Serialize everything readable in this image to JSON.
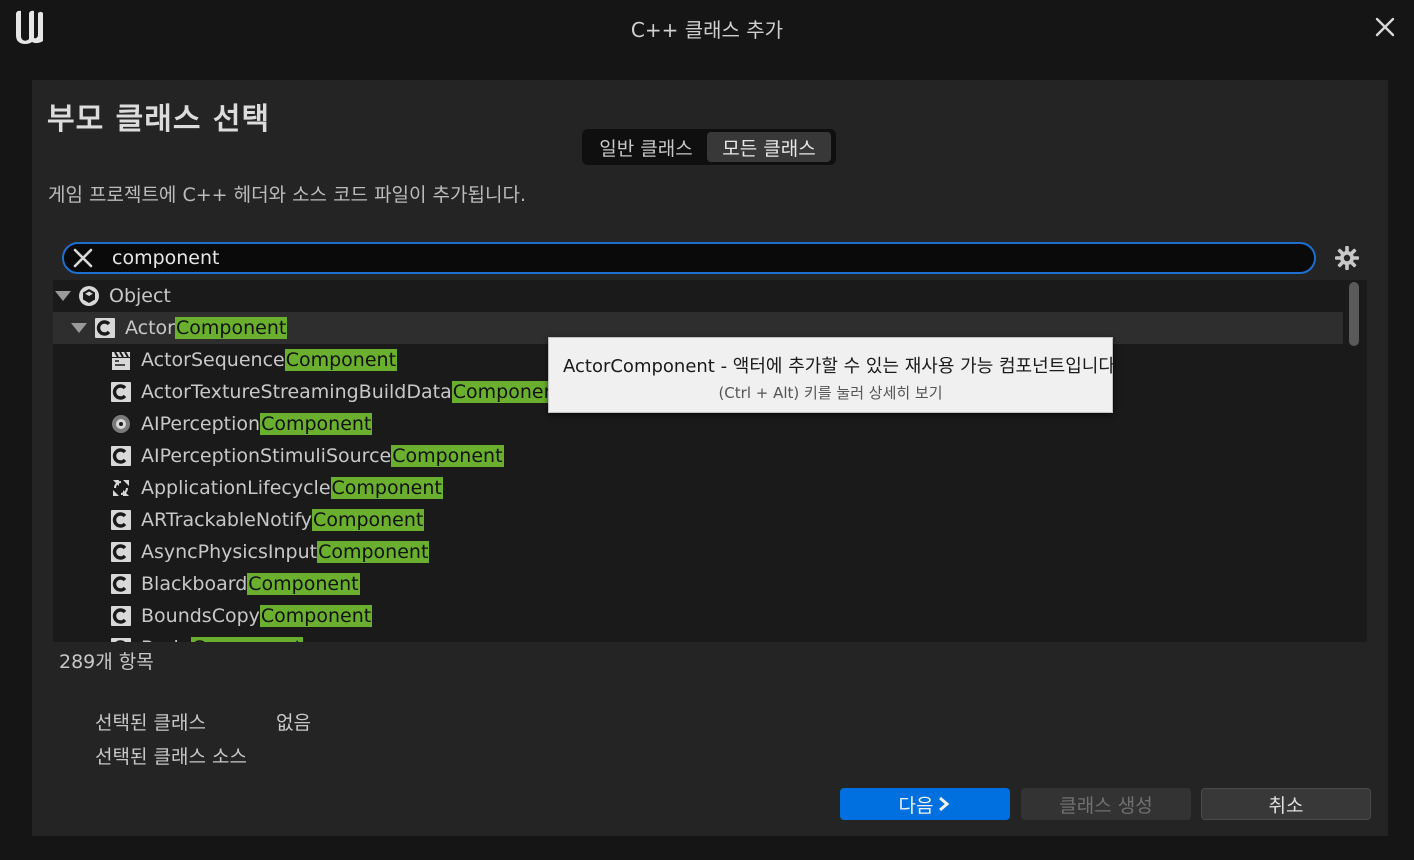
{
  "window": {
    "title": "C++ 클래스 추가",
    "logo_icon": "unreal-engine-logo",
    "close_icon": "close-icon"
  },
  "panel": {
    "heading": "부모 클래스 선택",
    "tabs": [
      {
        "label": "일반 클래스",
        "active": false
      },
      {
        "label": "모든 클래스",
        "active": true
      }
    ],
    "description": "게임 프로젝트에 C++ 헤더와 소스 코드 파일이 추가됩니다."
  },
  "search": {
    "value": "component",
    "clear_icon": "clear-x-icon",
    "settings_icon": "gear-icon"
  },
  "tree": {
    "highlight": "Component",
    "items": [
      {
        "prefix": "Object",
        "match": "",
        "icon": "object-sphere-icon",
        "expanded": true,
        "depth": 0
      },
      {
        "prefix": "Actor",
        "match": "Component",
        "icon": "class-c-icon",
        "expanded": true,
        "depth": 1,
        "selected": true
      },
      {
        "prefix": "ActorSequence",
        "match": "Component",
        "icon": "sequence-clapper-icon",
        "depth": 2
      },
      {
        "prefix": "ActorTextureStreamingBuildData",
        "match": "Component",
        "icon": "class-c-icon",
        "depth": 2
      },
      {
        "prefix": "AIPerception",
        "match": "Component",
        "icon": "ai-perception-icon",
        "depth": 2
      },
      {
        "prefix": "AIPerceptionStimuliSource",
        "match": "Component",
        "icon": "class-c-icon",
        "depth": 2
      },
      {
        "prefix": "ApplicationLifecycle",
        "match": "Component",
        "icon": "lifecycle-arrows-icon",
        "depth": 2
      },
      {
        "prefix": "ARTrackableNotify",
        "match": "Component",
        "icon": "class-c-icon",
        "depth": 2
      },
      {
        "prefix": "AsyncPhysicsInput",
        "match": "Component",
        "icon": "class-c-icon",
        "depth": 2
      },
      {
        "prefix": "Blackboard",
        "match": "Component",
        "icon": "class-c-icon",
        "depth": 2
      },
      {
        "prefix": "BoundsCopy",
        "match": "Component",
        "icon": "class-c-icon",
        "depth": 2
      },
      {
        "prefix": "Brain",
        "match": "Component",
        "icon": "class-c-icon",
        "depth": 2
      }
    ]
  },
  "count": "289개 항목",
  "selection": {
    "class_label": "선택된 클래스",
    "class_value": "없음",
    "source_label": "선택된 클래스 소스",
    "source_value": ""
  },
  "buttons": {
    "next": "다음",
    "next_icon": "chevron-right-icon",
    "create": "클래스 생성",
    "cancel": "취소"
  },
  "tooltip": {
    "main": "ActorComponent - 액터에 추가할 수 있는 재사용 가능 컴포넌트입니다.",
    "sub": "(Ctrl + Alt) 키를 눌러 상세히 보기"
  }
}
